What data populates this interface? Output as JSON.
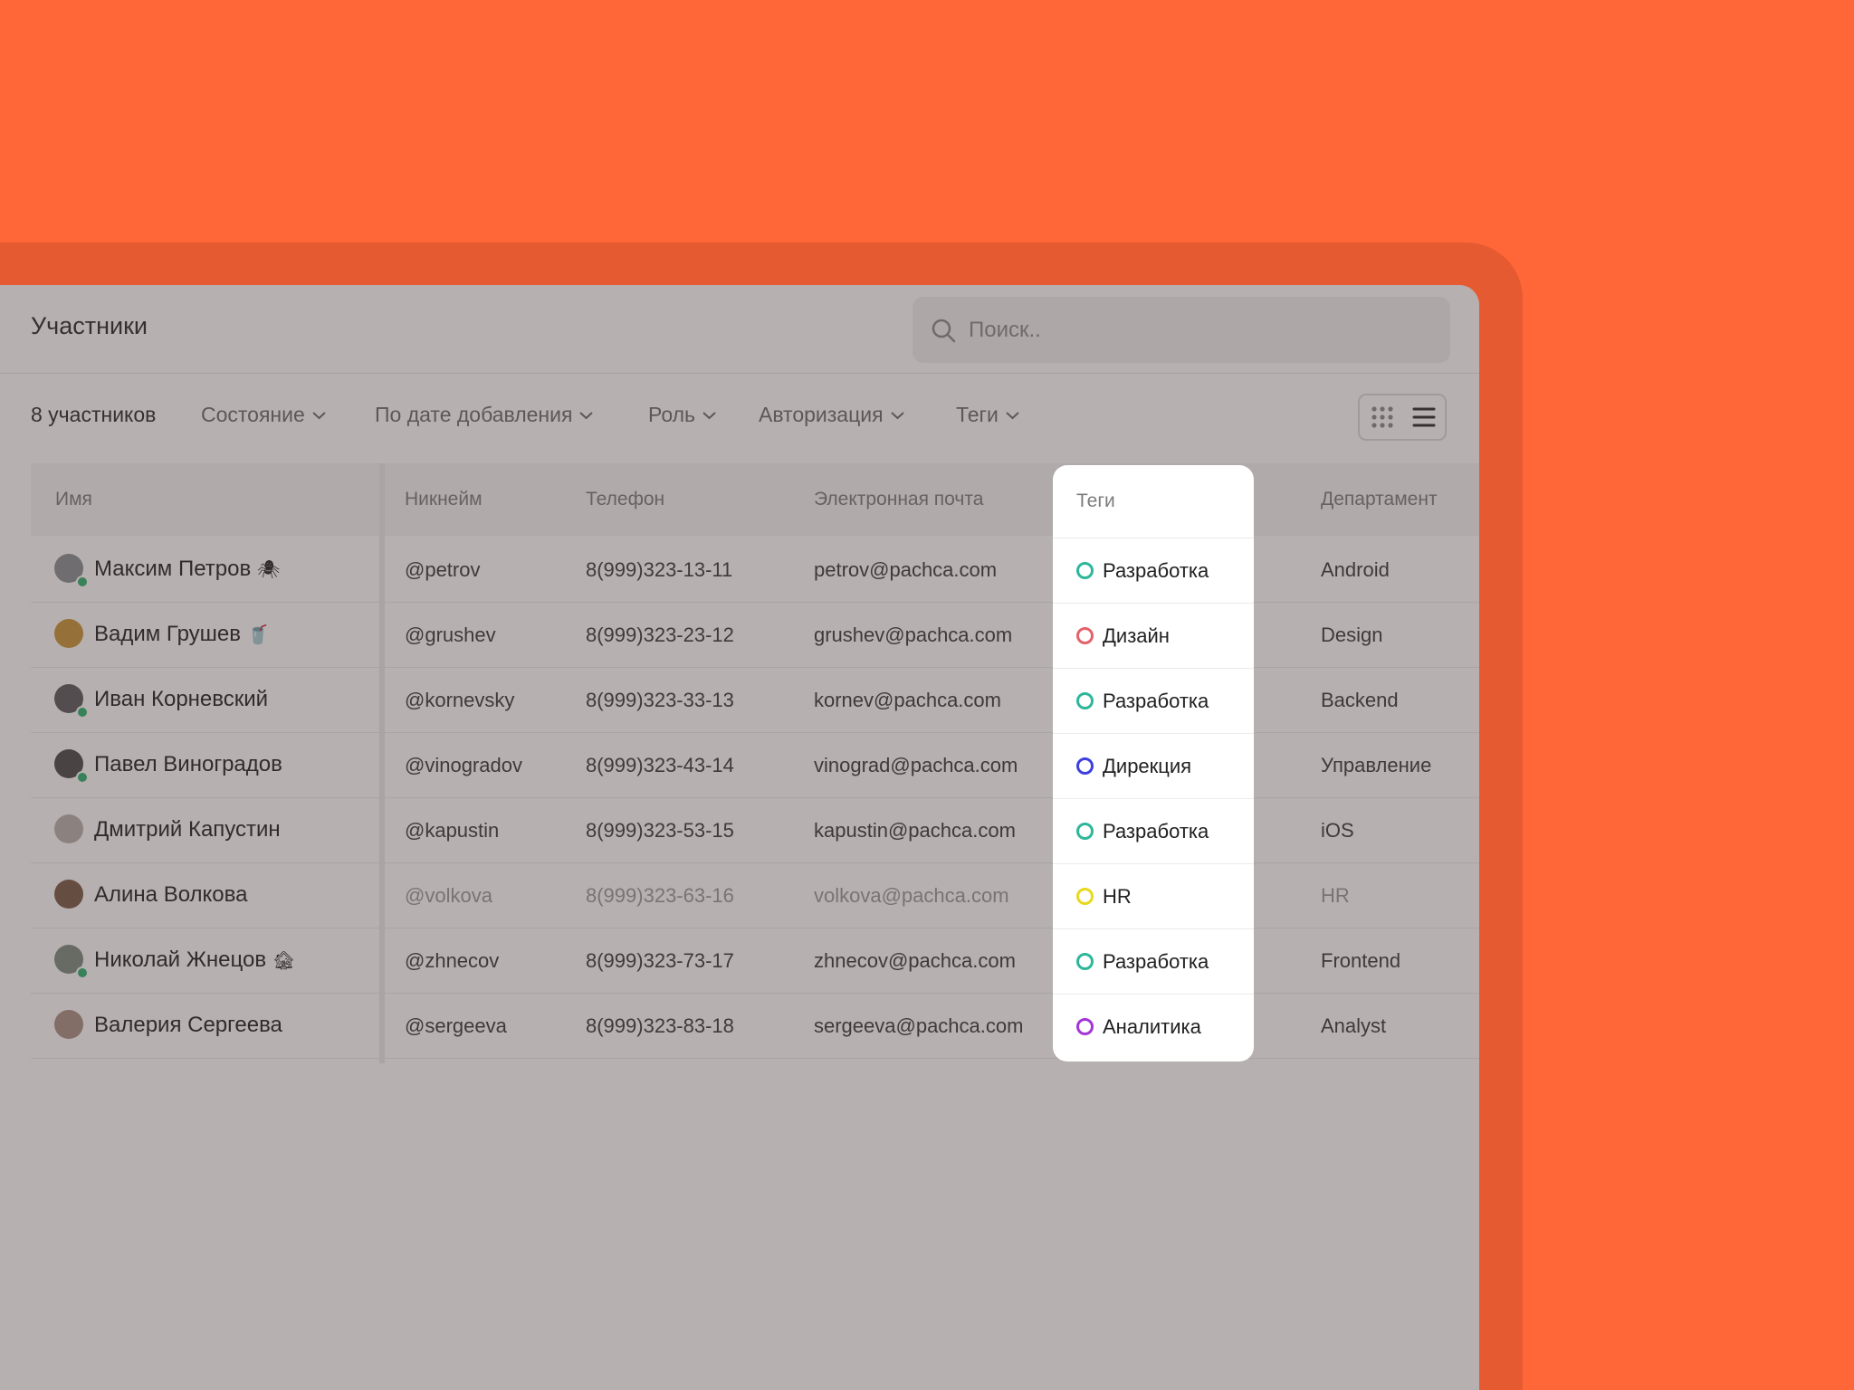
{
  "header": {
    "title": "Участники",
    "search_placeholder": "Поиск.."
  },
  "toolbar": {
    "count": "8 участников",
    "filters": [
      "Состояние",
      "По дате добавления",
      "Роль",
      "Авторизация",
      "Теги"
    ]
  },
  "table": {
    "columns": [
      "Имя",
      "Никнейм",
      "Телефон",
      "Электронная почта",
      "Теги",
      "Департамент"
    ],
    "rows": [
      {
        "name": "Максим Петров",
        "emoji": "🕷",
        "nick": "@petrov",
        "phone": "8(999)323-13-11",
        "email": "petrov@pachca.com",
        "tag": "Разработка",
        "tag_color": "#2DB79A",
        "dept": "Android",
        "avatar": "#8A8F94"
      },
      {
        "name": "Вадим Грушев",
        "emoji": "🥤",
        "nick": "@grushev",
        "phone": "8(999)323-23-12",
        "email": "grushev@pachca.com",
        "tag": "Дизайн",
        "tag_color": "#E5626A",
        "dept": "Design",
        "avatar": "#C9973A"
      },
      {
        "name": "Иван Корневский",
        "emoji": "",
        "nick": "@kornevsky",
        "phone": "8(999)323-33-13",
        "email": "kornev@pachca.com",
        "tag": "Разработка",
        "tag_color": "#2DB79A",
        "dept": "Backend",
        "avatar": "#5A5A5E"
      },
      {
        "name": "Павел Виноградов",
        "emoji": "",
        "nick": "@vinogradov",
        "phone": "8(999)323-43-14",
        "email": "vinograd@pachca.com",
        "tag": "Дирекция",
        "tag_color": "#3D3FE0",
        "dept": "Управление",
        "avatar": "#4A4A4A"
      },
      {
        "name": "Дмитрий Капустин",
        "emoji": "",
        "nick": "@kapustin",
        "phone": "8(999)323-53-15",
        "email": "kapustin@pachca.com",
        "tag": "Разработка",
        "tag_color": "#2DB79A",
        "dept": "iOS",
        "avatar": "#B7B2AE"
      },
      {
        "name": "Алина Волкова",
        "emoji": "",
        "nick": "@volkova",
        "phone": "8(999)323-63-16",
        "email": "volkova@pachca.com",
        "tag": "HR",
        "tag_color": "#E8D81C",
        "dept": "HR",
        "avatar": "#7A5A48",
        "muted": "yes"
      },
      {
        "name": "Николай Жнецов",
        "emoji": "🏚",
        "nick": "@zhnecov",
        "phone": "8(999)323-73-17",
        "email": "zhnecov@pachca.com",
        "tag": "Разработка",
        "tag_color": "#2DB79A",
        "dept": "Frontend",
        "avatar": "#7D8A80"
      },
      {
        "name": "Валерия Сергеева",
        "emoji": "",
        "nick": "@sergeeva",
        "phone": "8(999)323-83-18",
        "email": "sergeeva@pachca.com",
        "tag": "Аналитика",
        "tag_color": "#A335D6",
        "dept": "Analyst",
        "avatar": "#A88F86"
      }
    ]
  }
}
